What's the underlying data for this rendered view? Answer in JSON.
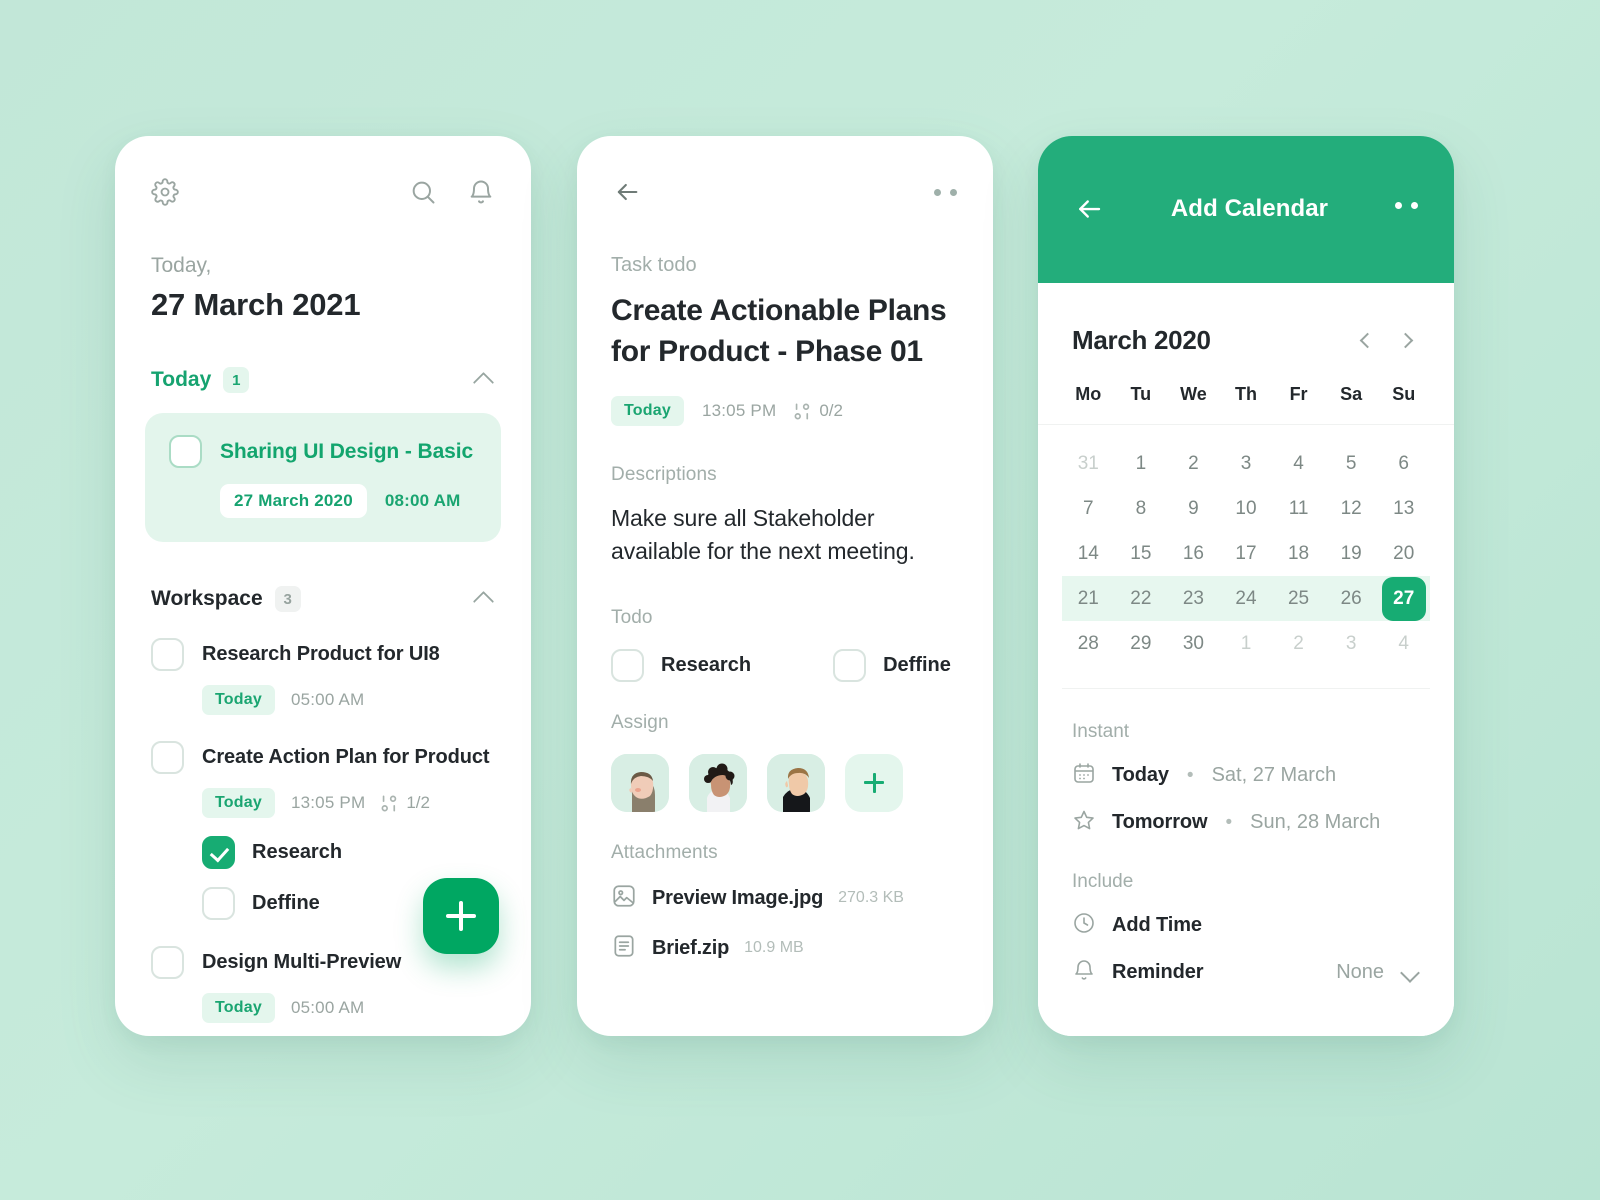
{
  "theme": {
    "accent": "#17ac73",
    "accent_header": "#23ad7b",
    "accent_fab": "#00a762",
    "accent_soft": "#e4f6ed",
    "background": "#c3e8d9",
    "text_dark": "#23282c",
    "text_muted": "#9aa5a1"
  },
  "phone1": {
    "icons": {
      "settings": "gear-icon",
      "search": "search-icon",
      "notifications": "bell-icon"
    },
    "today_label": "Today,",
    "date": "27 March 2021",
    "groups": [
      {
        "title": "Today",
        "count": "1"
      },
      {
        "title": "Workspace",
        "count": "3"
      }
    ],
    "highlight_task": {
      "title": "Sharing UI Design - Basic",
      "date": "27 March 2020",
      "time": "08:00 AM",
      "checked": false
    },
    "tasks": [
      {
        "title": "Research Product for UI8",
        "chip": "Today",
        "time": "05:00 AM",
        "checked": false,
        "progress": null,
        "subtasks": []
      },
      {
        "title": "Create Action Plan for Product",
        "chip": "Today",
        "time": "13:05 PM",
        "checked": false,
        "progress": "1/2",
        "subtasks": [
          {
            "label": "Research",
            "checked": true
          },
          {
            "label": "Deffine",
            "checked": false
          }
        ]
      },
      {
        "title": "Design Multi-Preview",
        "chip": "Today",
        "time": "05:00 AM",
        "checked": false,
        "progress": null,
        "subtasks": []
      }
    ],
    "fab_label": "+"
  },
  "phone2": {
    "back_icon": "arrow-left-icon",
    "menu_icon": "more-options-icon",
    "kicker": "Task todo",
    "title": "Create Actionable Plans for Product - Phase 01",
    "chip": "Today",
    "time": "13:05 PM",
    "progress": "0/2",
    "descriptions_label": "Descriptions",
    "description": "Make sure all Stakeholder available for the next meeting.",
    "todo_label": "Todo",
    "todos": [
      {
        "label": "Research",
        "checked": false
      },
      {
        "label": "Deffine",
        "checked": false
      }
    ],
    "assign_label": "Assign",
    "assignees": [
      "avatar-1",
      "avatar-2",
      "avatar-3"
    ],
    "add_assignee_label": "+",
    "attachments_label": "Attachments",
    "attachments": [
      {
        "icon": "image-file-icon",
        "name": "Preview Image.jpg",
        "size": "270.3 KB"
      },
      {
        "icon": "document-file-icon",
        "name": "Brief.zip",
        "size": "10.9 MB"
      }
    ]
  },
  "phone3": {
    "back_icon": "arrow-left-icon",
    "title": "Add Calendar",
    "menu_icon": "more-options-icon",
    "calendar": {
      "month": "March 2020",
      "prev_label": "‹",
      "next_label": "›",
      "weekdays": [
        "Mo",
        "Tu",
        "We",
        "Th",
        "Fr",
        "Sa",
        "Su"
      ],
      "weeks": [
        [
          {
            "d": "31",
            "state": "out"
          },
          {
            "d": "1",
            "state": "cur"
          },
          {
            "d": "2",
            "state": "cur"
          },
          {
            "d": "3",
            "state": "cur"
          },
          {
            "d": "4",
            "state": "cur"
          },
          {
            "d": "5",
            "state": "cur"
          },
          {
            "d": "6",
            "state": "cur"
          }
        ],
        [
          {
            "d": "7",
            "state": "cur"
          },
          {
            "d": "8",
            "state": "cur"
          },
          {
            "d": "9",
            "state": "cur"
          },
          {
            "d": "10",
            "state": "cur"
          },
          {
            "d": "11",
            "state": "cur"
          },
          {
            "d": "12",
            "state": "cur"
          },
          {
            "d": "13",
            "state": "cur"
          }
        ],
        [
          {
            "d": "14",
            "state": "cur"
          },
          {
            "d": "15",
            "state": "cur"
          },
          {
            "d": "16",
            "state": "cur"
          },
          {
            "d": "17",
            "state": "cur"
          },
          {
            "d": "18",
            "state": "cur"
          },
          {
            "d": "19",
            "state": "cur"
          },
          {
            "d": "20",
            "state": "cur"
          }
        ],
        [
          {
            "d": "21",
            "state": "cur"
          },
          {
            "d": "22",
            "state": "cur"
          },
          {
            "d": "23",
            "state": "cur"
          },
          {
            "d": "24",
            "state": "cur"
          },
          {
            "d": "25",
            "state": "cur"
          },
          {
            "d": "26",
            "state": "cur"
          },
          {
            "d": "27",
            "state": "selected"
          }
        ],
        [
          {
            "d": "28",
            "state": "cur"
          },
          {
            "d": "29",
            "state": "cur"
          },
          {
            "d": "30",
            "state": "cur"
          },
          {
            "d": "1",
            "state": "out"
          },
          {
            "d": "2",
            "state": "out"
          },
          {
            "d": "3",
            "state": "out"
          },
          {
            "d": "4",
            "state": "out"
          }
        ]
      ],
      "selected_week_index": 3
    },
    "instant_label": "Instant",
    "instant": [
      {
        "icon": "calendar-icon",
        "name": "Today",
        "sub": "Sat, 27 March"
      },
      {
        "icon": "star-icon",
        "name": "Tomorrow",
        "sub": "Sun, 28 March"
      }
    ],
    "include_label": "Include",
    "include": [
      {
        "icon": "clock-icon",
        "name": "Add Time",
        "value": ""
      },
      {
        "icon": "bell-icon",
        "name": "Reminder",
        "value": "None"
      }
    ]
  }
}
